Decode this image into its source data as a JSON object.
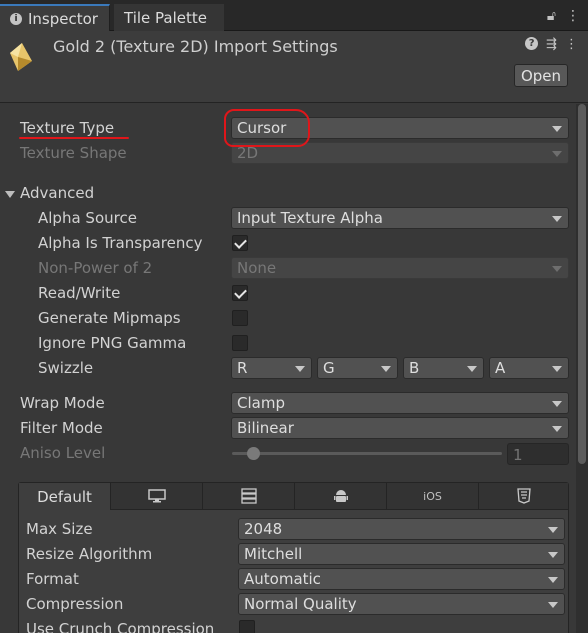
{
  "tabs": {
    "inspector": "Inspector",
    "tile_palette": "Tile Palette"
  },
  "header": {
    "title": "Gold 2 (Texture 2D) Import Settings",
    "open_button": "Open"
  },
  "texture_type": {
    "label": "Texture Type",
    "value": "Cursor"
  },
  "texture_shape": {
    "label": "Texture Shape",
    "value": "2D"
  },
  "advanced": {
    "label": "Advanced",
    "alpha_source": {
      "label": "Alpha Source",
      "value": "Input Texture Alpha"
    },
    "alpha_is_transparency": {
      "label": "Alpha Is Transparency",
      "checked": true
    },
    "non_power_of_2": {
      "label": "Non-Power of 2",
      "value": "None"
    },
    "read_write": {
      "label": "Read/Write",
      "checked": true
    },
    "generate_mipmaps": {
      "label": "Generate Mipmaps",
      "checked": false
    },
    "ignore_png_gamma": {
      "label": "Ignore PNG Gamma",
      "checked": false
    },
    "swizzle": {
      "label": "Swizzle",
      "r": "R",
      "g": "G",
      "b": "B",
      "a": "A"
    }
  },
  "wrap_mode": {
    "label": "Wrap Mode",
    "value": "Clamp"
  },
  "filter_mode": {
    "label": "Filter Mode",
    "value": "Bilinear"
  },
  "aniso_level": {
    "label": "Aniso Level",
    "value": "1"
  },
  "platform_tabs": {
    "default": "Default",
    "icons": [
      "monitor-icon",
      "server-icon",
      "android-icon",
      "ios",
      "html5-icon"
    ],
    "ios_label": "iOS"
  },
  "platform": {
    "max_size": {
      "label": "Max Size",
      "value": "2048"
    },
    "resize_algorithm": {
      "label": "Resize Algorithm",
      "value": "Mitchell"
    },
    "format": {
      "label": "Format",
      "value": "Automatic"
    },
    "compression": {
      "label": "Compression",
      "value": "Normal Quality"
    },
    "use_crunch": {
      "label": "Use Crunch Compression",
      "checked": false
    }
  },
  "colors": {
    "accent_tab": "#3a79bb",
    "annotation": "#e0161a"
  }
}
